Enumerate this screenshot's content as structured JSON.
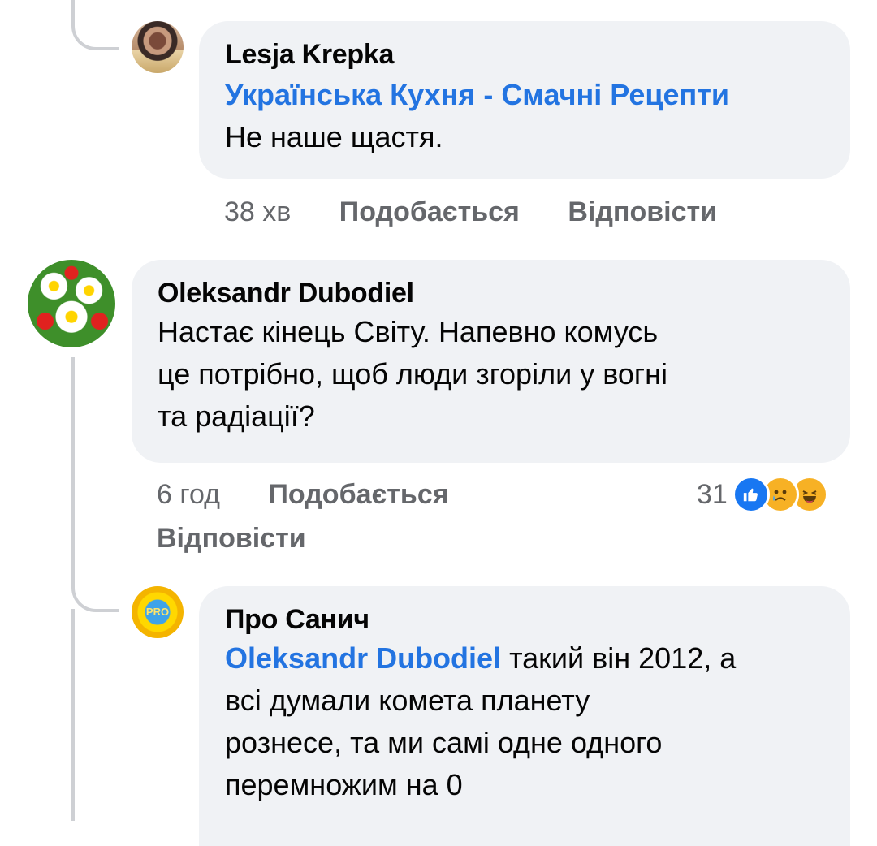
{
  "comments": [
    {
      "author": "Lesja Krepka",
      "mention": "Українська Кухня - Смачні Рецепти",
      "text": "Не наше щастя.",
      "time": "38 хв",
      "like_label": "Подобається",
      "reply_label": "Відповісти"
    },
    {
      "author": "Oleksandr Dubodiel",
      "text_lines": [
        "Настає кінець Світу. Напевно комусь",
        "це потрібно, щоб люди згоріли у вогні",
        "та радіації?"
      ],
      "time": "6 год",
      "like_label": "Подобається",
      "reply_label": "Відповісти",
      "reactions": {
        "count": "31",
        "icons": [
          "like-icon",
          "sad-icon",
          "haha-icon"
        ]
      }
    },
    {
      "author": "Про Санич",
      "mention": "Oleksandr Dubodiel",
      "text_first": " такий він 2012, а",
      "text_lines": [
        "всі думали комета планету",
        "рознесе, та ми самі одне одного",
        "перемножим на 0"
      ],
      "avatar_text": "PRO"
    }
  ],
  "colors": {
    "bubble": "#f0f2f5",
    "link": "#2374e1",
    "meta": "#65676b",
    "line": "#ced0d4"
  }
}
